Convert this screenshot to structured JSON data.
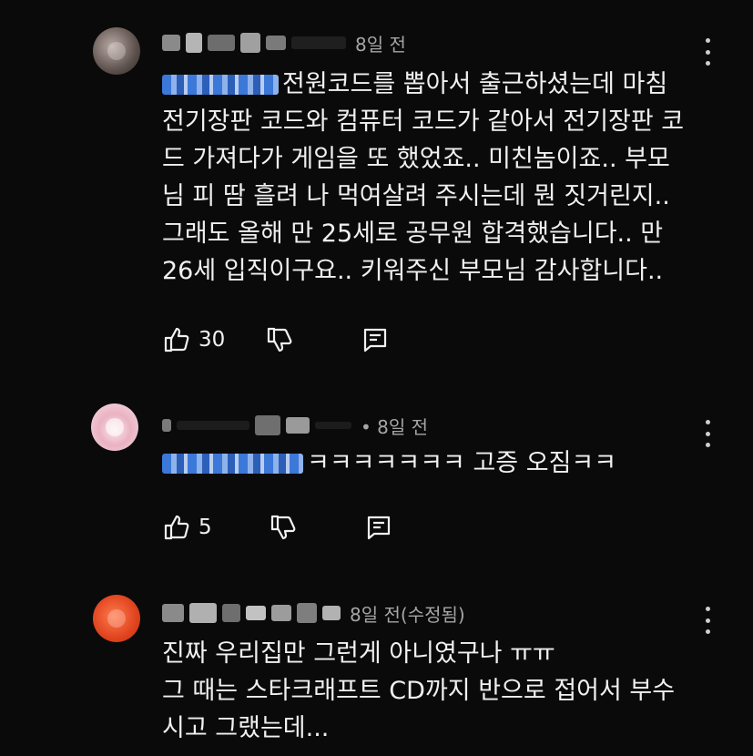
{
  "comments": [
    {
      "time": "8일 전",
      "lines": [
        "전원코드를 뽑아서 출근하셨는데 마침",
        "전기장판 코드와 컴퓨터 코드가 같아서 전기장판 코",
        "드 가져다가 게임을 또 했었죠.. 미친놈이죠.. 부모",
        "님 피 땀 흘려 나 먹여살려 주시는데 뭔 짓거린지..",
        "그래도 올해 만 25세로 공무원 합격했습니다.. 만",
        "26세 입직이구요.. 키워주신 부모님 감사합니다.."
      ],
      "likes": "30"
    },
    {
      "time": "• 8일 전",
      "lines": [
        "ㅋㅋㅋㅋㅋㅋㅋ 고증 오짐ㅋㅋ"
      ],
      "likes": "5"
    },
    {
      "time": "8일 전(수정됨)",
      "lines": [
        "진짜 우리집만 그런게 아니였구나 ㅠㅠ",
        "그 때는 스타크래프트 CD까지 반으로 접어서 부수",
        "시고 그랬는데..."
      ]
    }
  ],
  "icons": {
    "like": "thumbs-up-icon",
    "dislike": "thumbs-down-icon",
    "reply": "reply-icon",
    "menu": "more-vert-icon"
  }
}
